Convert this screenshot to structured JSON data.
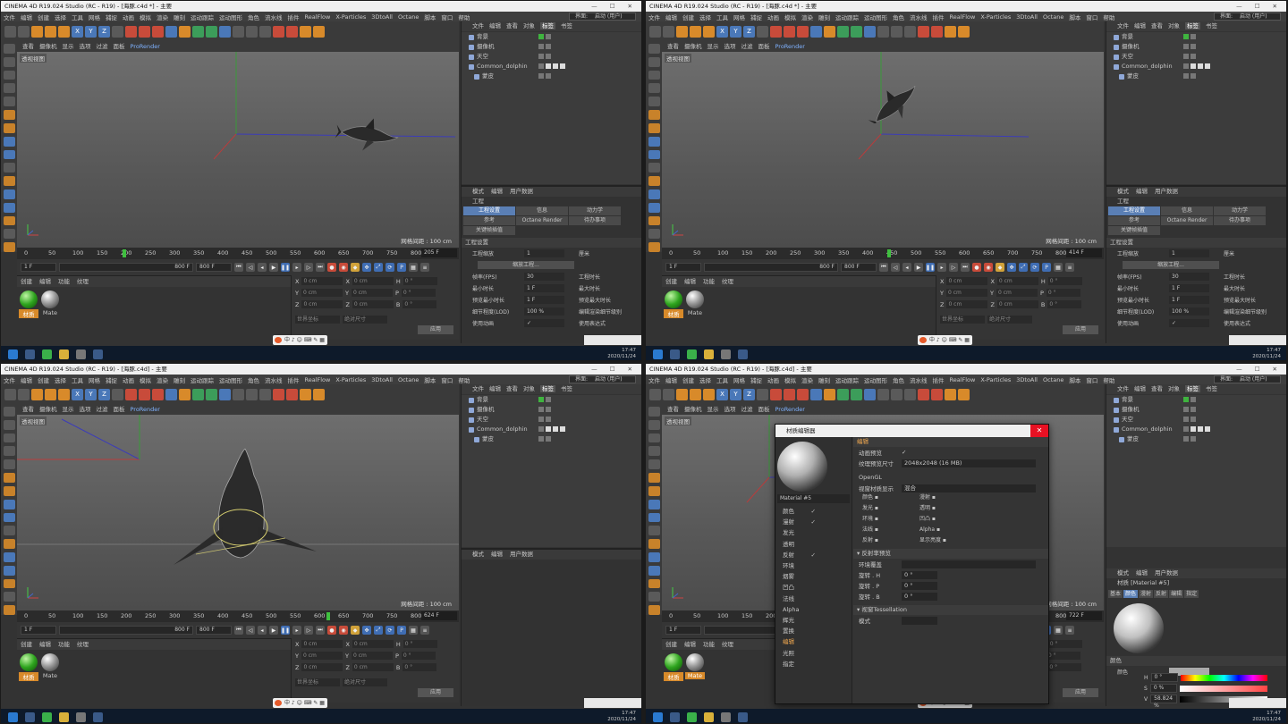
{
  "app": {
    "title_top": "CINEMA 4D R19.024 Studio (RC - R19) - [海豚.c4d *] - 主要",
    "title_bottom": "CINEMA 4D R19.024 Studio (RC - R19) - [海豚.c4d] - 主要",
    "window_controls": "—  ☐  ✕",
    "menus": [
      "文件",
      "编辑",
      "创建",
      "选择",
      "工具",
      "网格",
      "捕捉",
      "动画",
      "模拟",
      "渲染",
      "雕刻",
      "运动跟踪",
      "运动图形",
      "角色",
      "流水线",
      "插件",
      "RealFlow",
      "X-Particles",
      "3DtoAll",
      "Octane",
      "脚本",
      "窗口",
      "帮助"
    ],
    "layout_label": "界面:",
    "layout_value": "启动 (用户)"
  },
  "toolbar": {
    "icons": [
      "undo-icon",
      "live-select-icon",
      "move-icon",
      "scale-icon",
      "rotate-icon",
      "x-axis-icon",
      "y-axis-icon",
      "z-axis-icon",
      "coord-icon",
      "render-view-icon",
      "render-icon",
      "render-settings-icon",
      "cube-icon",
      "pen-icon",
      "subdivision-icon",
      "array-icon",
      "deformer-icon",
      "floor-icon",
      "camera-icon",
      "light-icon",
      "xp-icon",
      "xp2-icon",
      "emitter-icon",
      "snap-icon"
    ],
    "axis_letters": [
      "X",
      "Y",
      "Z"
    ]
  },
  "viewport": {
    "menu": [
      "查看",
      "摄像机",
      "显示",
      "选项",
      "过滤",
      "面板"
    ],
    "prorender": "ProRender",
    "label": "透视视图",
    "grid_text": "网格间距 : 100 cm"
  },
  "timeline": {
    "ticks": [
      "0",
      "50",
      "100",
      "150",
      "200",
      "250",
      "300",
      "350",
      "400",
      "450",
      "500",
      "550",
      "600",
      "650",
      "700",
      "750",
      "800"
    ],
    "frames": [
      "205 F",
      "414 F",
      "624 F",
      "722 F"
    ],
    "start": "1 F",
    "end": "800 F",
    "end2": "800 F"
  },
  "material_panel": {
    "menu": [
      "创建",
      "编辑",
      "功能",
      "纹理"
    ],
    "materials": [
      "材质",
      "Mate"
    ]
  },
  "coords": {
    "rows": [
      {
        "a": "X",
        "v1": "0 cm",
        "b": "X",
        "v2": "0 cm",
        "c": "H",
        "v3": "0 °"
      },
      {
        "a": "Y",
        "v1": "0 cm",
        "b": "Y",
        "v2": "0 cm",
        "c": "P",
        "v3": "0 °"
      },
      {
        "a": "Z",
        "v1": "0 cm",
        "b": "Z",
        "v2": "0 cm",
        "c": "B",
        "v3": "0 °"
      }
    ],
    "mode1": "世界坐标",
    "mode2": "绝对尺寸",
    "apply": "应用"
  },
  "object_manager": {
    "menu": [
      "文件",
      "编辑",
      "查看",
      "对象",
      "标签",
      "书签"
    ],
    "objects": [
      {
        "name": "背景",
        "icon": "background-icon"
      },
      {
        "name": "摄像机",
        "icon": "camera-icon"
      },
      {
        "name": "天空",
        "icon": "sky-icon"
      },
      {
        "name": "Common_dolphin",
        "icon": "polygon-icon"
      },
      {
        "name": "蒙皮",
        "icon": "skin-icon"
      }
    ]
  },
  "attributes": {
    "menu": [
      "模式",
      "编辑",
      "用户数据"
    ],
    "title": "工程",
    "tabs": [
      "工程设置",
      "信息",
      "动力学",
      "参考",
      "Octane Render",
      "待办事项",
      "关键帧插值"
    ],
    "section": "工程设置",
    "rows": [
      {
        "label": "工程缩放",
        "value": "1",
        "unit": "厘米"
      },
      {
        "label": "帧率(FPS)",
        "value": "30",
        "right": "工程时长"
      },
      {
        "label": "最小时长",
        "value": "1 F",
        "right": "最大时长"
      },
      {
        "label": "预览最小时长",
        "value": "1 F",
        "right": "预览最大时长"
      },
      {
        "label": "细节程度(LOD)",
        "value": "100 %",
        "right": "编辑渲染细节级别"
      },
      {
        "label": "使用动画",
        "value": "✓",
        "right": "使用表达式"
      }
    ],
    "scale_button": "缩放工程..."
  },
  "material_editor": {
    "title": "材质编辑器",
    "name": "Material #5",
    "channels": [
      {
        "name": "颜色",
        "checked": "✓"
      },
      {
        "name": "漫射",
        "checked": "✓"
      },
      {
        "name": "发光",
        "checked": ""
      },
      {
        "name": "透明",
        "checked": ""
      },
      {
        "name": "反射",
        "checked": "✓"
      },
      {
        "name": "环境",
        "checked": ""
      },
      {
        "name": "烟雾",
        "checked": ""
      },
      {
        "name": "凹凸",
        "checked": ""
      },
      {
        "name": "法线",
        "checked": ""
      },
      {
        "name": "Alpha",
        "checked": ""
      },
      {
        "name": "辉光",
        "checked": ""
      },
      {
        "name": "置换",
        "checked": ""
      },
      {
        "name": "编辑",
        "checked": ""
      },
      {
        "name": "光照",
        "checked": ""
      },
      {
        "name": "指定",
        "checked": ""
      }
    ],
    "selected_channel": "编辑",
    "header": "编辑",
    "anim_preview": "动画预览",
    "tex_preview_size_label": "纹理预览尺寸",
    "tex_preview_size": "2048x2048 (16 MB)",
    "opengl": "OpenGL",
    "viewport_display_label": "视窗材质显示",
    "viewport_display": "混合",
    "gl_grid": [
      "颜色",
      "漫射",
      "发光",
      "透明",
      "环境",
      "凹凸",
      "法线",
      "Alpha",
      "反射",
      "显示亮度"
    ],
    "reflect_section": "▾ 反射率预览",
    "env_override": "环境覆盖",
    "rot_h": "0 °",
    "rot_p": "0 °",
    "rot_b": "0 °",
    "rot_labels": [
      "旋转 . H",
      "旋转 . P",
      "旋转 . B"
    ],
    "tess_section": "▾ 视窗Tessellation",
    "tess_mode": "模式"
  },
  "material_attr": {
    "title": "材质 [Material #5]",
    "tabs": [
      "基本",
      "颜色",
      "漫射",
      "反射",
      "编辑",
      "指定"
    ],
    "color_label": "颜色",
    "color_sub": "颜色",
    "h_label": "H",
    "h_value": "0 °",
    "s_label": "S",
    "s_value": "0 %",
    "v_label": "V",
    "v_value": "58.824 %"
  },
  "taskbar": {
    "time": "17:47",
    "date": "2020/11/24",
    "ime": "中 ♪ ☺ ⌨ ✎ ▦"
  }
}
